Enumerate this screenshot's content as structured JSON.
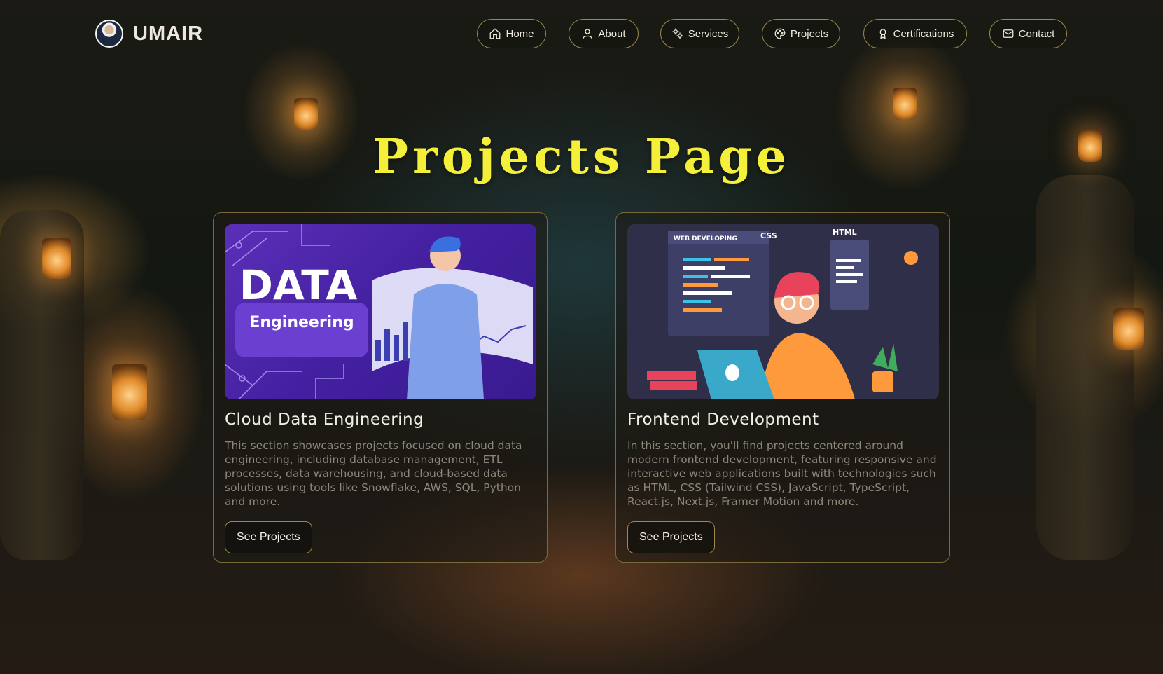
{
  "brand": {
    "name": "UMAIR"
  },
  "nav": {
    "items": [
      {
        "label": "Home",
        "icon": "home-icon"
      },
      {
        "label": "About",
        "icon": "user-icon"
      },
      {
        "label": "Services",
        "icon": "gears-icon"
      },
      {
        "label": "Projects",
        "icon": "palette-icon"
      },
      {
        "label": "Certifications",
        "icon": "award-icon"
      },
      {
        "label": "Contact",
        "icon": "mail-icon"
      }
    ]
  },
  "page": {
    "title": "Projects Page"
  },
  "cards": [
    {
      "title": "Cloud Data Engineering",
      "description": "This section showcases projects focused on cloud data engineering, including database management, ETL processes, data warehousing, and cloud-based data solutions using tools like Snowflake, AWS, SQL, Python and more.",
      "button": "See Projects",
      "image_text": {
        "big": "DATA",
        "tag": "Engineering"
      }
    },
    {
      "title": "Frontend Development",
      "description": "In this section, you'll find projects centered around modern frontend development, featuring responsive and interactive web applications built with technologies such as HTML, CSS (Tailwind CSS), JavaScript, TypeScript, React.js, Next.js, Framer Motion and more.",
      "button": "See Projects",
      "image_text": {
        "window": "WEB DEVELOPING",
        "css": "CSS",
        "html": "HTML"
      }
    }
  ],
  "colors": {
    "title": "#f4f03a",
    "accent_border": "#9c8a4c"
  }
}
